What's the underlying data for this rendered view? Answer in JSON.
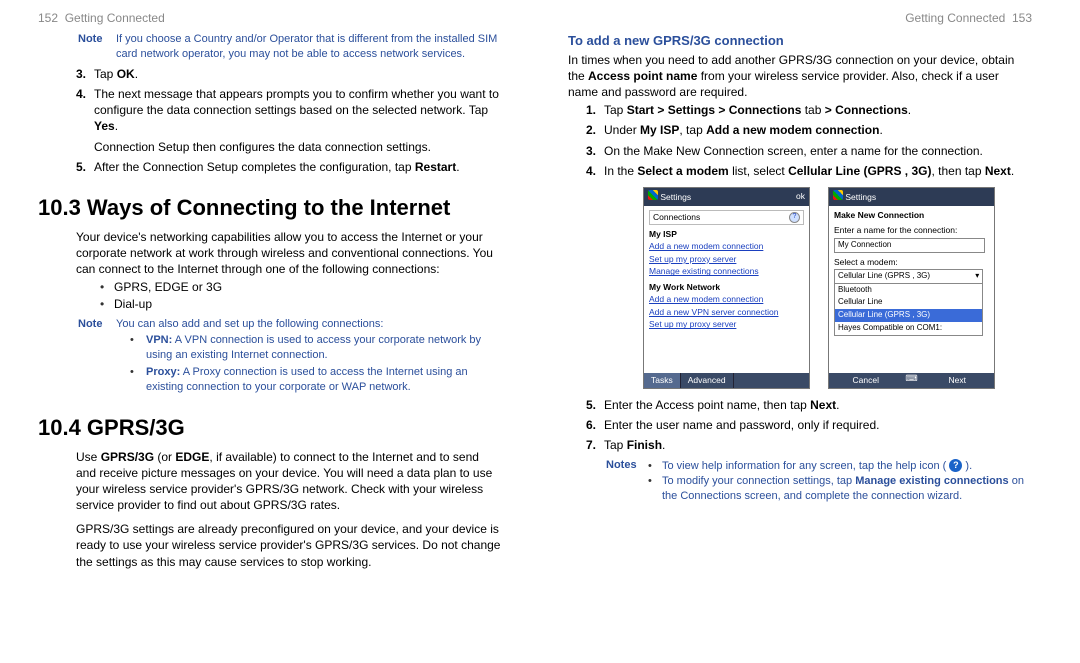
{
  "left": {
    "runhead_num": "152",
    "runhead_title": "Getting Connected",
    "note1_label": "Note",
    "note1_body": "If you choose a Country and/or Operator that is different from the installed SIM card network operator, you may not be able to access network services.",
    "steps_a": [
      {
        "n": "3.",
        "t_pre": "Tap ",
        "t_b": "OK",
        "t_post": "."
      },
      {
        "n": "4.",
        "t_pre": "The next message that appears prompts you to confirm whether you want to configure the data connection settings based on the selected network. Tap ",
        "t_b": "Yes",
        "t_post": "."
      }
    ],
    "para_conn": "Connection Setup then configures the data connection settings.",
    "steps_b": [
      {
        "n": "5.",
        "t_pre": "After the Connection Setup completes the configuration, tap ",
        "t_b": "Restart",
        "t_post": "."
      }
    ],
    "h103": "10.3  Ways of Connecting to the Internet",
    "p103": "Your device's networking capabilities allow you to access the Internet or your corporate network at work through wireless and conventional connections. You can connect to the Internet through one of the following connections:",
    "bullets103": [
      "GPRS, EDGE or 3G",
      "Dial-up"
    ],
    "note2_label": "Note",
    "note2_body": "You can also add and set up the following connections:",
    "note2_items": [
      {
        "b": "VPN:",
        "t": " A VPN connection is used to access your corporate network by using an existing Internet connection."
      },
      {
        "b": "Proxy:",
        "t": " A Proxy connection is used to access the Internet using an existing connection to your corporate or WAP network."
      }
    ],
    "h104": "10.4  GPRS/3G",
    "p104a_pre": "Use ",
    "p104a_b1": "GPRS/3G",
    "p104a_mid": " (or ",
    "p104a_b2": "EDGE",
    "p104a_post": ", if available) to connect to the Internet and to send and receive picture messages on your device. You will need a data plan to use your wireless service provider's GPRS/3G network. Check with your wireless service provider to find out about GPRS/3G rates.",
    "p104b": "GPRS/3G settings are already preconfigured on your device, and your device is ready to use your wireless service provider's GPRS/3G services. Do not change the settings as this may cause services to stop working."
  },
  "right": {
    "runhead_title": "Getting Connected",
    "runhead_num": "153",
    "hsub": "To add a new GPRS/3G connection",
    "p_intro_pre": "In times when you need to add another GPRS/3G connection on your device, obtain the ",
    "p_intro_b": "Access point name",
    "p_intro_post": " from your wireless service provider. Also, check if a user name and password are required.",
    "steps_c": [
      {
        "n": "1.",
        "html": "Tap <b class='kw'>Start > Settings > Connections</b> tab <b class='kw'>> Connections</b>."
      },
      {
        "n": "2.",
        "html": "Under <b class='kw'>My ISP</b>, tap <b class='kw'>Add a new modem connection</b>."
      },
      {
        "n": "3.",
        "html": "On the Make New Connection screen, enter a name for the connection."
      },
      {
        "n": "4.",
        "html": "In the <b class='kw'>Select a modem</b> list, select <b class='kw'>Cellular Line (GPRS , 3G)</b>, then tap <b class='kw'>Next</b>."
      }
    ],
    "screens": {
      "s1": {
        "title": "Settings",
        "ok": "ok",
        "section": "Connections",
        "cat1": "My ISP",
        "links1": [
          "Add a new modem connection",
          "Set up my proxy server",
          "Manage existing connections"
        ],
        "cat2": "My Work Network",
        "links2": [
          "Add a new modem connection",
          "Add a new VPN server connection",
          "Set up my proxy server"
        ],
        "tab1": "Tasks",
        "tab2": "Advanced"
      },
      "s2": {
        "title": "Settings",
        "heading": "Make New Connection",
        "lbl_name": "Enter a name for the connection:",
        "val_name": "My Connection",
        "lbl_modem": "Select a modem:",
        "val_modem": "Cellular Line (GPRS , 3G)",
        "opts": [
          "Bluetooth",
          "Cellular Line",
          "Cellular Line (GPRS , 3G)",
          "Hayes Compatible on COM1:"
        ],
        "btn_cancel": "Cancel",
        "btn_next": "Next"
      }
    },
    "steps_d": [
      {
        "n": "5.",
        "html": "Enter the Access point name, then tap <b class='kw'>Next</b>."
      },
      {
        "n": "6.",
        "html": "Enter the user name and password, only if required."
      },
      {
        "n": "7.",
        "html": "Tap <b class='kw'>Finish</b>."
      }
    ],
    "notes_label": "Notes",
    "notes_items": [
      {
        "pre": "To view help information for any screen, tap the help icon ( ",
        "post": " ).",
        "icon": true
      },
      {
        "pre": "To modify your connection settings, tap ",
        "b": "Manage existing connections",
        "post": " on the Connections screen, and complete the connection wizard."
      }
    ]
  }
}
